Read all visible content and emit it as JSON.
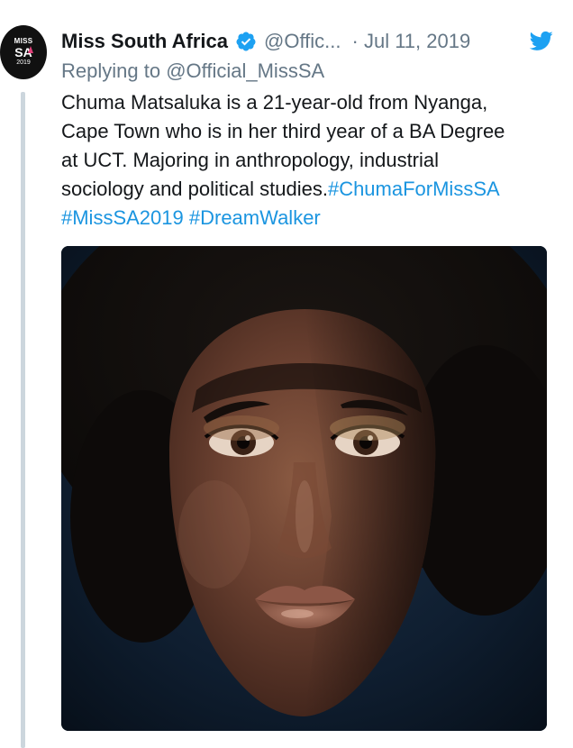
{
  "tweet": {
    "avatar": {
      "line1": "MISS",
      "line2": "SA",
      "line3": "2019"
    },
    "display_name": "Miss South Africa",
    "handle": "@Offic...",
    "date_separator": "·",
    "date": "Jul 11, 2019",
    "replying_prefix": "Replying to",
    "replying_to": "@Official_MissSA",
    "text_lines": {
      "l1": "Chuma Matsaluka is a 21-year-old from Nyanga,",
      "l2": "Cape Town who is in her third year of a BA Degree",
      "l3": "at UCT. Majoring in anthropology, industrial",
      "l4": "sociology and political studies.",
      "l5_hashtag1": "#MissSA2019",
      "l5_hashtag2": "#DreamWalker"
    },
    "hashtag_inline": "#ChumaForMissSA",
    "icons": {
      "verified": "verified-badge-icon",
      "platform": "twitter-bird-icon"
    },
    "colors": {
      "link": "#1b95e0",
      "verified": "#1da1f2",
      "secondary_text": "#657786",
      "primary_text": "#14171a",
      "thread_line": "#ccd6dd"
    }
  }
}
